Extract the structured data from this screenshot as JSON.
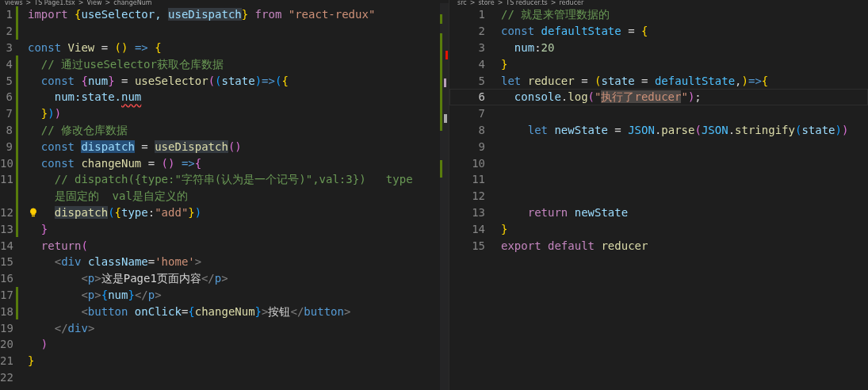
{
  "left_editor": {
    "breadcrumbs": [
      "views",
      ">",
      "TS Page1.tsx",
      ">",
      "View",
      ">",
      "changeNum"
    ],
    "lines": [
      {
        "num": "1",
        "modified": true,
        "tokens": [
          {
            "t": "import ",
            "kind": "ctl"
          },
          {
            "t": "{",
            "kind": "y"
          },
          {
            "t": "useSelector, ",
            "kind": "var"
          },
          {
            "t": "useDispatch",
            "kind": "var-hl"
          },
          {
            "t": "}",
            "kind": "y"
          },
          {
            "t": " from ",
            "kind": "ctl"
          },
          {
            "t": "\"react-redux\"",
            "kind": "str"
          }
        ]
      },
      {
        "num": "2",
        "modified": true
      },
      {
        "num": "3",
        "modified": false,
        "tokens": [
          {
            "t": "const ",
            "kind": "kw"
          },
          {
            "t": "View",
            "kind": "fn"
          },
          {
            "t": " = ",
            "kind": "p"
          },
          {
            "t": "()",
            "kind": "y"
          },
          {
            "t": " => ",
            "kind": "kw"
          },
          {
            "t": "{",
            "kind": "y"
          }
        ]
      },
      {
        "num": "4",
        "modified": true,
        "tokens": [
          {
            "t": "  // 通过useSelector获取仓库数据",
            "kind": "cm"
          }
        ]
      },
      {
        "num": "5",
        "modified": true,
        "tokens": [
          {
            "t": "  const ",
            "kind": "kw"
          },
          {
            "t": "{",
            "kind": "m"
          },
          {
            "t": "num",
            "kind": "var"
          },
          {
            "t": "}",
            "kind": "m"
          },
          {
            "t": " = ",
            "kind": "p"
          },
          {
            "t": "useSelector",
            "kind": "fn"
          },
          {
            "t": "(",
            "kind": "m"
          },
          {
            "t": "(",
            "kind": "b"
          },
          {
            "t": "state",
            "kind": "var"
          },
          {
            "t": ")",
            "kind": "b"
          },
          {
            "t": "=>",
            "kind": "kw"
          },
          {
            "t": "(",
            "kind": "b"
          },
          {
            "t": "{",
            "kind": "y"
          }
        ]
      },
      {
        "num": "6",
        "modified": true,
        "tokens": [
          {
            "t": "    num:state.",
            "kind": "var"
          },
          {
            "t": "num",
            "kind": "var-err"
          }
        ]
      },
      {
        "num": "7",
        "modified": true,
        "tokens": [
          {
            "t": "  }",
            "kind": "y"
          },
          {
            "t": ")",
            "kind": "b"
          },
          {
            "t": ")",
            "kind": "m"
          }
        ]
      },
      {
        "num": "8",
        "modified": true,
        "tokens": [
          {
            "t": "  // 修改仓库数据",
            "kind": "cm"
          }
        ]
      },
      {
        "num": "9",
        "modified": true,
        "tokens": [
          {
            "t": "  const ",
            "kind": "kw"
          },
          {
            "t": "dispatch",
            "kind": "var-sel"
          },
          {
            "t": " = ",
            "kind": "p"
          },
          {
            "t": "useDispatch",
            "kind": "fn-hl"
          },
          {
            "t": "()",
            "kind": "m"
          }
        ]
      },
      {
        "num": "10",
        "modified": true,
        "tokens": [
          {
            "t": "  const ",
            "kind": "kw"
          },
          {
            "t": "changeNum",
            "kind": "fn"
          },
          {
            "t": " = ",
            "kind": "p"
          },
          {
            "t": "()",
            "kind": "m"
          },
          {
            "t": " =>",
            "kind": "kw"
          },
          {
            "t": "{",
            "kind": "m"
          }
        ]
      },
      {
        "num": "11",
        "modified": true,
        "tokens": [
          {
            "t": "    // dispatch({type:\"字符串(认为是一个记号)\",val:3})   type",
            "kind": "cm"
          }
        ],
        "wrapped": [
          {
            "t": "    是固定的  val是自定义的",
            "kind": "cm"
          }
        ]
      },
      {
        "num": "12",
        "modified": true,
        "lightbulb": true,
        "kind": "indented",
        "tokens": [
          {
            "t": "dispatch",
            "kind": "fn-hl"
          },
          {
            "t": "(",
            "kind": "b"
          },
          {
            "t": "{",
            "kind": "y"
          },
          {
            "t": "type",
            "kind": "var"
          },
          {
            "t": ":",
            "kind": "p"
          },
          {
            "t": "\"add\"",
            "kind": "str"
          },
          {
            "t": "}",
            "kind": "y"
          },
          {
            "t": ")",
            "kind": "b"
          }
        ]
      },
      {
        "num": "13",
        "modified": true,
        "tokens": [
          {
            "t": "  }",
            "kind": "m"
          }
        ]
      },
      {
        "num": "14",
        "modified": false,
        "tokens": [
          {
            "t": "  return",
            "kind": "ctl"
          },
          {
            "t": "(",
            "kind": "m"
          }
        ]
      },
      {
        "num": "15",
        "modified": false,
        "tokens": [
          {
            "t": "    <",
            "kind": "tag"
          },
          {
            "t": "div",
            "kind": "tn"
          },
          {
            "t": " className",
            "kind": "var"
          },
          {
            "t": "=",
            "kind": "p"
          },
          {
            "t": "'home'",
            "kind": "str"
          },
          {
            "t": ">",
            "kind": "tag"
          }
        ]
      },
      {
        "num": "16",
        "modified": false,
        "tokens": [
          {
            "t": "        <",
            "kind": "tag"
          },
          {
            "t": "p",
            "kind": "tn"
          },
          {
            "t": ">",
            "kind": "tag"
          },
          {
            "t": "这是Page1页面内容",
            "kind": "p"
          },
          {
            "t": "</",
            "kind": "tag"
          },
          {
            "t": "p",
            "kind": "tn"
          },
          {
            "t": ">",
            "kind": "tag"
          }
        ]
      },
      {
        "num": "17",
        "modified": true,
        "tokens": [
          {
            "t": "        <",
            "kind": "tag"
          },
          {
            "t": "p",
            "kind": "tn"
          },
          {
            "t": ">",
            "kind": "tag"
          },
          {
            "t": "{",
            "kind": "b"
          },
          {
            "t": "num",
            "kind": "var"
          },
          {
            "t": "}",
            "kind": "b"
          },
          {
            "t": "</",
            "kind": "tag"
          },
          {
            "t": "p",
            "kind": "tn"
          },
          {
            "t": ">",
            "kind": "tag"
          }
        ]
      },
      {
        "num": "18",
        "modified": true,
        "tokens": [
          {
            "t": "        <",
            "kind": "tag"
          },
          {
            "t": "button",
            "kind": "tn"
          },
          {
            "t": " onClick",
            "kind": "var"
          },
          {
            "t": "=",
            "kind": "p"
          },
          {
            "t": "{",
            "kind": "b"
          },
          {
            "t": "changeNum",
            "kind": "fn"
          },
          {
            "t": "}",
            "kind": "b"
          },
          {
            "t": ">",
            "kind": "tag"
          },
          {
            "t": "按钮",
            "kind": "p"
          },
          {
            "t": "</",
            "kind": "tag"
          },
          {
            "t": "button",
            "kind": "tn"
          },
          {
            "t": ">",
            "kind": "tag"
          }
        ]
      },
      {
        "num": "19",
        "modified": false,
        "tokens": [
          {
            "t": "    </",
            "kind": "tag"
          },
          {
            "t": "div",
            "kind": "tn"
          },
          {
            "t": ">",
            "kind": "tag"
          }
        ]
      },
      {
        "num": "20",
        "modified": false,
        "tokens": [
          {
            "t": "  )",
            "kind": "m"
          }
        ]
      },
      {
        "num": "21",
        "modified": false,
        "tokens": [
          {
            "t": "}",
            "kind": "y"
          }
        ]
      },
      {
        "num": "22",
        "modified": false
      }
    ]
  },
  "right_editor": {
    "breadcrumbs": [
      "src",
      ">",
      "store",
      ">",
      "TS reducer.ts",
      ">",
      "reducer"
    ],
    "lines": [
      {
        "num": "1",
        "current": false,
        "tokens": [
          {
            "t": "// 就是来管理数据的",
            "kind": "cm"
          }
        ]
      },
      {
        "num": "2",
        "current": false,
        "tokens": [
          {
            "t": "const ",
            "kind": "kw"
          },
          {
            "t": "defaultState",
            "kind": "const"
          },
          {
            "t": " = ",
            "kind": "p"
          },
          {
            "t": "{",
            "kind": "y"
          }
        ]
      },
      {
        "num": "3",
        "current": false,
        "tokens": [
          {
            "t": "  num",
            "kind": "var"
          },
          {
            "t": ":",
            "kind": "p"
          },
          {
            "t": "20",
            "kind": "num"
          }
        ]
      },
      {
        "num": "4",
        "current": false,
        "tokens": [
          {
            "t": "}",
            "kind": "y"
          }
        ]
      },
      {
        "num": "5",
        "current": false,
        "tokens": [
          {
            "t": "let ",
            "kind": "kw"
          },
          {
            "t": "reducer",
            "kind": "fn"
          },
          {
            "t": " = ",
            "kind": "p"
          },
          {
            "t": "(",
            "kind": "y"
          },
          {
            "t": "state",
            "kind": "var"
          },
          {
            "t": " = ",
            "kind": "p"
          },
          {
            "t": "defaultState",
            "kind": "const"
          },
          {
            "t": ",",
            "kind": "p"
          },
          {
            "t": ")",
            "kind": "y"
          },
          {
            "t": "=>",
            "kind": "kw"
          },
          {
            "t": "{",
            "kind": "y"
          }
        ]
      },
      {
        "num": "6",
        "current": true,
        "tokens": [
          {
            "t": "  console",
            "kind": "var"
          },
          {
            "t": ".",
            "kind": "p"
          },
          {
            "t": "log",
            "kind": "fn"
          },
          {
            "t": "(",
            "kind": "m"
          },
          {
            "t": "\"",
            "kind": "str"
          },
          {
            "t": "执行了reducer",
            "kind": "str-sel"
          },
          {
            "t": "\"",
            "kind": "str"
          },
          {
            "t": ")",
            "kind": "m"
          },
          {
            "t": ";",
            "kind": "p"
          }
        ]
      },
      {
        "num": "7",
        "current": false
      },
      {
        "num": "8",
        "current": false,
        "tokens": [
          {
            "t": "    let ",
            "kind": "kw"
          },
          {
            "t": "newState",
            "kind": "var"
          },
          {
            "t": " = ",
            "kind": "p"
          },
          {
            "t": "JSON",
            "kind": "const"
          },
          {
            "t": ".",
            "kind": "p"
          },
          {
            "t": "parse",
            "kind": "fn"
          },
          {
            "t": "(",
            "kind": "m"
          },
          {
            "t": "JSON",
            "kind": "const"
          },
          {
            "t": ".",
            "kind": "p"
          },
          {
            "t": "stringify",
            "kind": "fn"
          },
          {
            "t": "(",
            "kind": "b"
          },
          {
            "t": "state",
            "kind": "var"
          },
          {
            "t": ")",
            "kind": "b"
          },
          {
            "t": ")",
            "kind": "m"
          }
        ]
      },
      {
        "num": "9",
        "current": false
      },
      {
        "num": "10",
        "current": false
      },
      {
        "num": "11",
        "current": false
      },
      {
        "num": "12",
        "current": false
      },
      {
        "num": "13",
        "current": false,
        "tokens": [
          {
            "t": "    return ",
            "kind": "ctl"
          },
          {
            "t": "newState",
            "kind": "var"
          }
        ]
      },
      {
        "num": "14",
        "current": false,
        "tokens": [
          {
            "t": "}",
            "kind": "y"
          }
        ]
      },
      {
        "num": "15",
        "current": false,
        "tokens": [
          {
            "t": "export default ",
            "kind": "ctl"
          },
          {
            "t": "reducer",
            "kind": "fn"
          }
        ]
      }
    ]
  }
}
